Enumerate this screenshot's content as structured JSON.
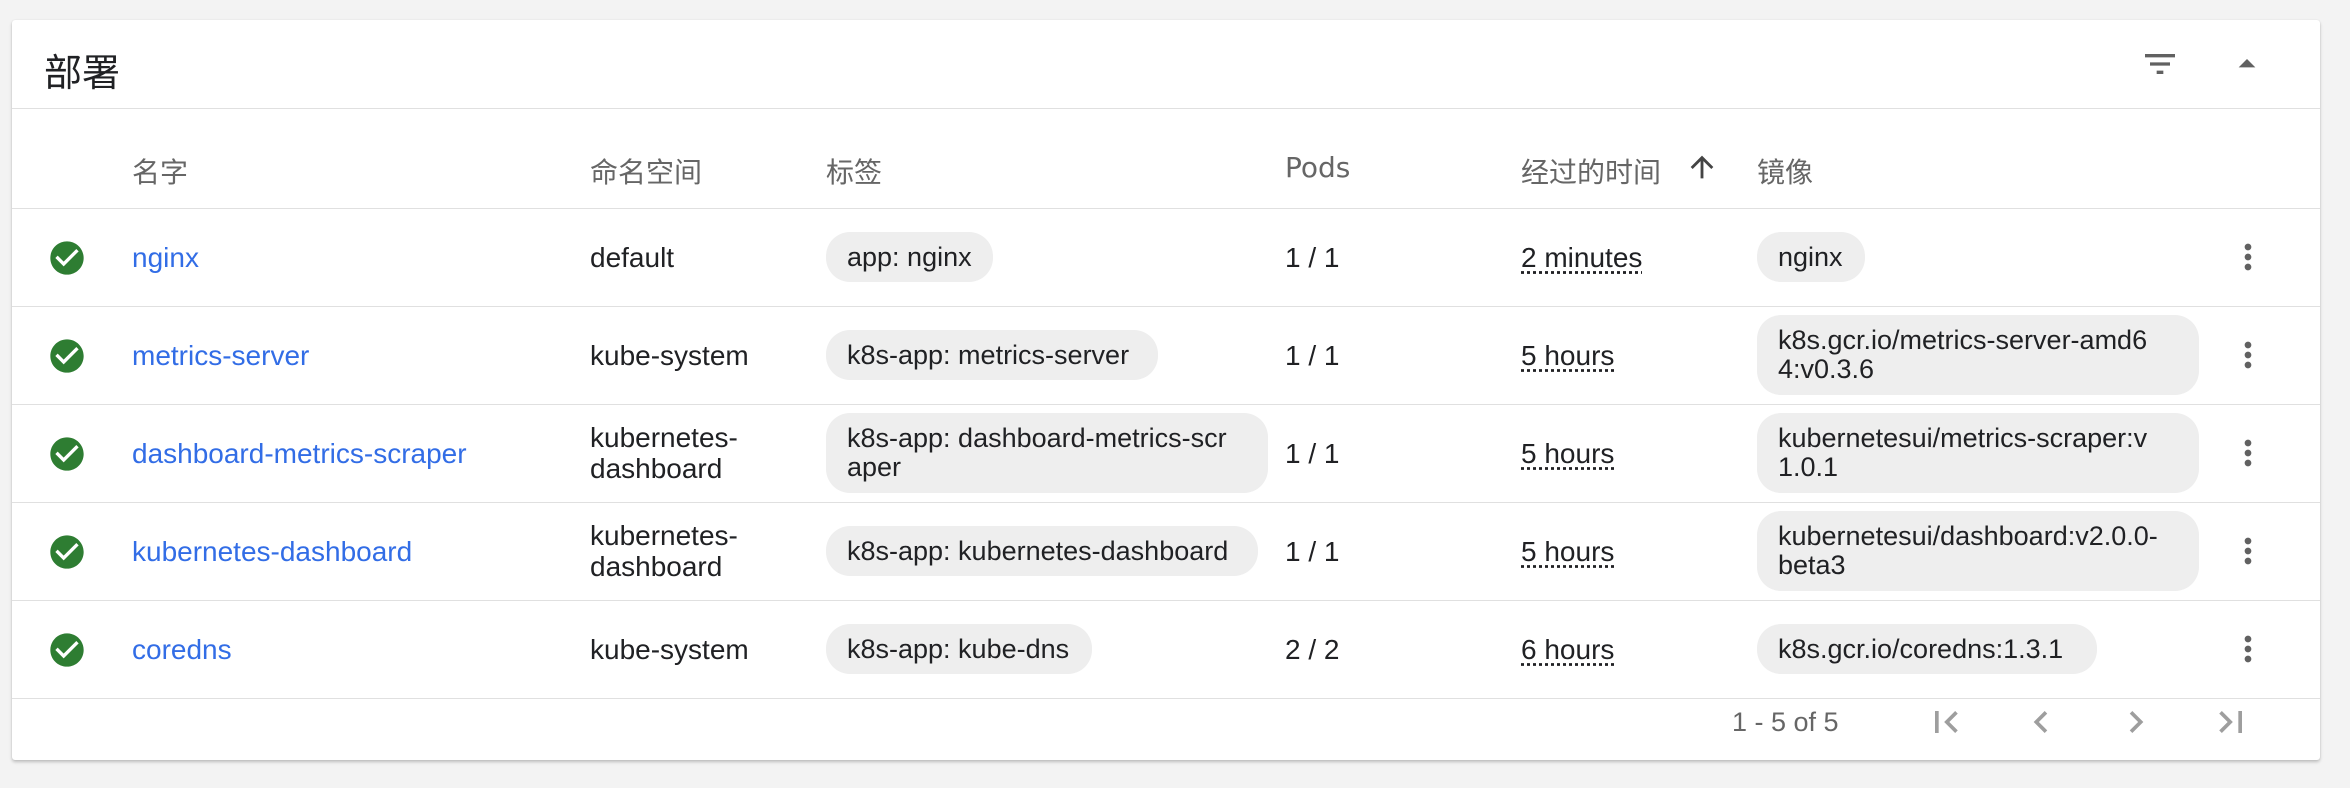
{
  "card": {
    "title": "部署",
    "icons": {
      "filter": "filter-icon",
      "collapse": "collapse-arrow-icon"
    }
  },
  "columns": {
    "name": "名字",
    "namespace": "命名空间",
    "labels": "标签",
    "pods": "Pods",
    "age": "经过的时间",
    "images": "镜像"
  },
  "sort": {
    "column": "age",
    "direction": "ascending",
    "icon": "arrow-up-icon"
  },
  "colors": {
    "link": "#326de6",
    "status_ok": "#2e7d32",
    "chip_bg": "#eeeeee"
  },
  "rows": [
    {
      "status": "success",
      "name": "nginx",
      "namespace": [
        "default"
      ],
      "label": [
        "app: nginx"
      ],
      "pods": "1 / 1",
      "age": "2 minutes",
      "image": [
        "nginx"
      ]
    },
    {
      "status": "success",
      "name": "metrics-server",
      "namespace": [
        "kube-system"
      ],
      "label": [
        "k8s-app: metrics-server"
      ],
      "pods": "1 / 1",
      "age": "5 hours",
      "image": [
        "k8s.gcr.io/metrics-server-amd6",
        "4:v0.3.6"
      ]
    },
    {
      "status": "success",
      "name": "dashboard-metrics-scraper",
      "namespace": [
        "kubernetes-",
        "dashboard"
      ],
      "label": [
        "k8s-app: dashboard-metrics-scr",
        "aper"
      ],
      "pods": "1 / 1",
      "age": "5 hours",
      "image": [
        "kubernetesui/metrics-scraper:v",
        "1.0.1"
      ]
    },
    {
      "status": "success",
      "name": "kubernetes-dashboard",
      "namespace": [
        "kubernetes-",
        "dashboard"
      ],
      "label": [
        "k8s-app: kubernetes-dashboard"
      ],
      "pods": "1 / 1",
      "age": "5 hours",
      "image": [
        "kubernetesui/dashboard:v2.0.0-",
        "beta3"
      ]
    },
    {
      "status": "success",
      "name": "coredns",
      "namespace": [
        "kube-system"
      ],
      "label": [
        "k8s-app: kube-dns"
      ],
      "pods": "2 / 2",
      "age": "6 hours",
      "image": [
        "k8s.gcr.io/coredns:1.3.1"
      ]
    }
  ],
  "paginator": {
    "range": "1 - 5 of 5",
    "buttons": [
      "first-page-icon",
      "previous-page-icon",
      "next-page-icon",
      "last-page-icon"
    ]
  }
}
